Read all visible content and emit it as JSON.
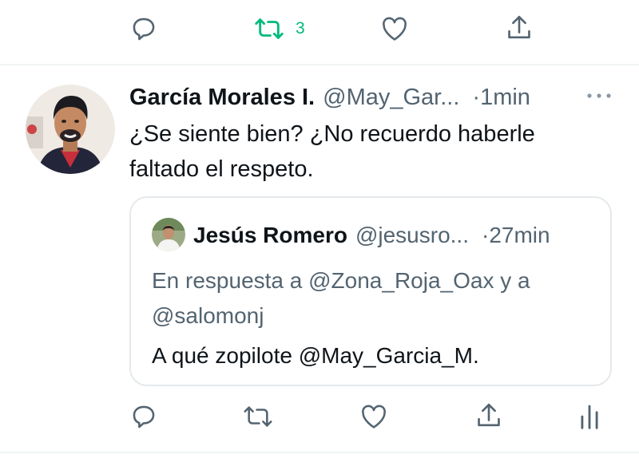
{
  "previous_tweet_actions": {
    "retweet_count": "3",
    "colors": {
      "icon": "#536471",
      "retweet_active": "#00ba7c"
    }
  },
  "tweet": {
    "author_name": "García Morales I.",
    "author_handle": "@May_Gar...",
    "time": "·1min",
    "text_line1": "¿Se siente bien? ¿No recuerdo haberle",
    "text_line2": "faltado el respeto."
  },
  "quoted_tweet": {
    "author_name": "Jesús Romero",
    "author_handle": "@jesusro...",
    "time": "·27min",
    "reply_line1": "En respuesta a @Zona_Roja_Oax y a",
    "reply_line2": "@salomonj",
    "text": "A qué zopilote @May_Garcia_M."
  },
  "icons": [
    "reply-icon",
    "retweet-icon",
    "like-icon",
    "share-icon",
    "more-icon",
    "analytics-icon"
  ]
}
